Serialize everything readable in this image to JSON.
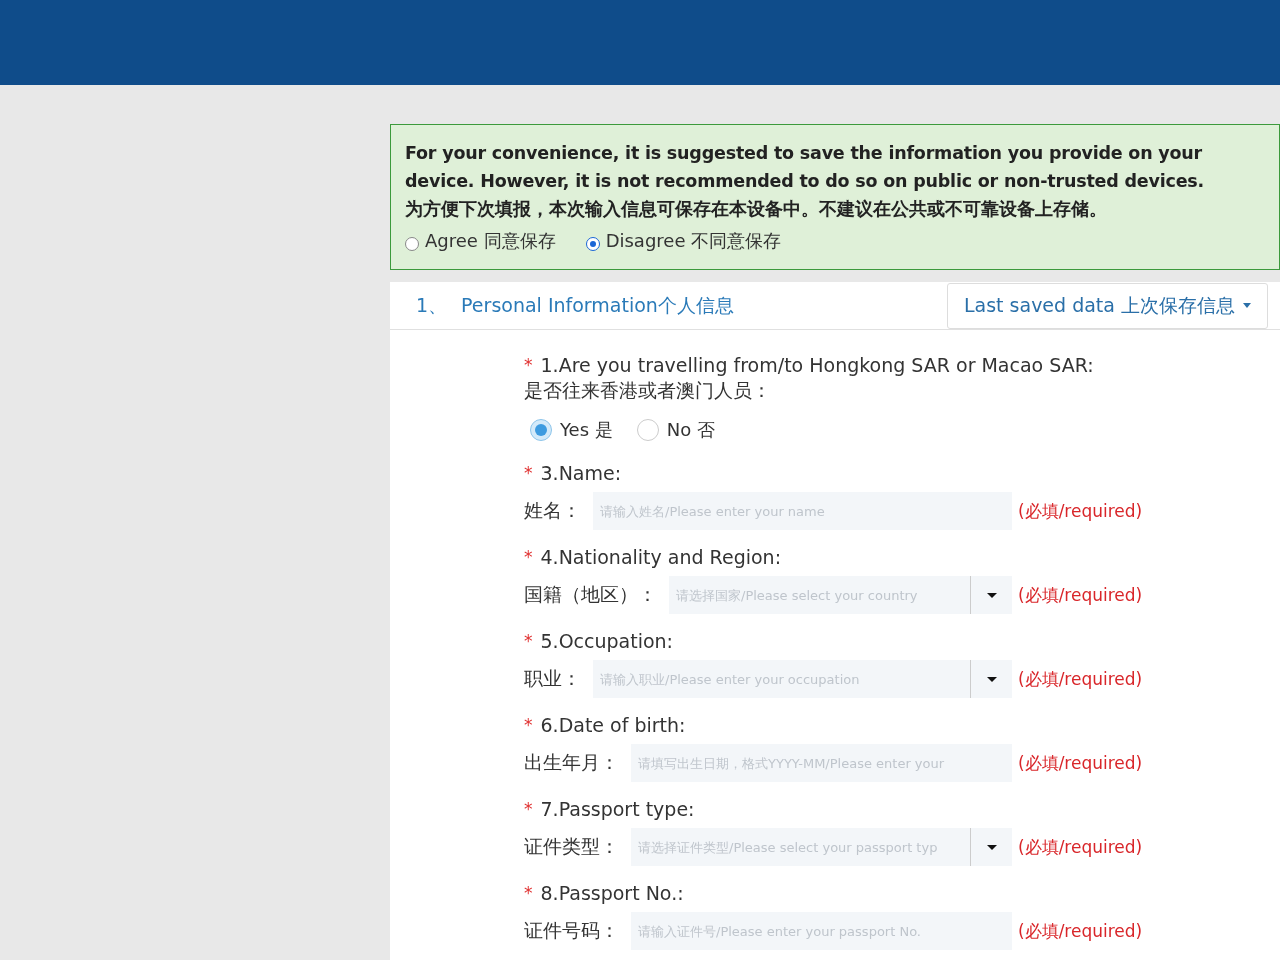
{
  "notice": {
    "text": "For your convenience, it is suggested to save the information you provide on your device. However, it is not recommended to do so on public or non-trusted devices.",
    "text_cn": "为方便下次填报，本次输入信息可保存在本设备中。不建议在公共或不可靠设备上存储。",
    "options": [
      {
        "label": "Agree 同意保存",
        "selected": false
      },
      {
        "label": "Disagree 不同意保存",
        "selected": true
      }
    ]
  },
  "section": {
    "number": "1、",
    "title": "Personal Information个人信息",
    "saved_button": "Last saved data 上次保存信息"
  },
  "questions": [
    {
      "kind": "radio",
      "asterisk": "*",
      "title": "1.Are you travelling from/to Hongkong SAR or Macao SAR:",
      "subtitle": "是否往来香港或者澳门人员：",
      "options": [
        {
          "label": "Yes 是",
          "selected": true
        },
        {
          "label": "No 否",
          "selected": false
        }
      ]
    },
    {
      "kind": "text",
      "asterisk": "*",
      "title": "3.Name:",
      "label": "姓名：",
      "placeholder": "请输入姓名/Please enter your name",
      "required": "(必填/required)"
    },
    {
      "kind": "select",
      "asterisk": "*",
      "title": "4.Nationality and Region:",
      "label": "国籍（地区）：",
      "placeholder": "请选择国家/Please select your country",
      "required": "(必填/required)"
    },
    {
      "kind": "select",
      "asterisk": "*",
      "title": "5.Occupation:",
      "label": "职业：",
      "placeholder": "请输入职业/Please enter your occupation",
      "required": "(必填/required)"
    },
    {
      "kind": "text",
      "asterisk": "*",
      "title": "6.Date of birth:",
      "label": "出生年月：",
      "placeholder": "请填写出生日期，格式YYYY-MM/Please enter your",
      "required": "(必填/required)"
    },
    {
      "kind": "select",
      "asterisk": "*",
      "title": "7.Passport type:",
      "label": "证件类型：",
      "placeholder": "请选择证件类型/Please select your passport typ",
      "required": "(必填/required)"
    },
    {
      "kind": "text",
      "asterisk": "*",
      "title": "8.Passport No.:",
      "label": "证件号码：",
      "placeholder": "请输入证件号/Please enter your passport No.",
      "required": "(必填/required)"
    }
  ]
}
